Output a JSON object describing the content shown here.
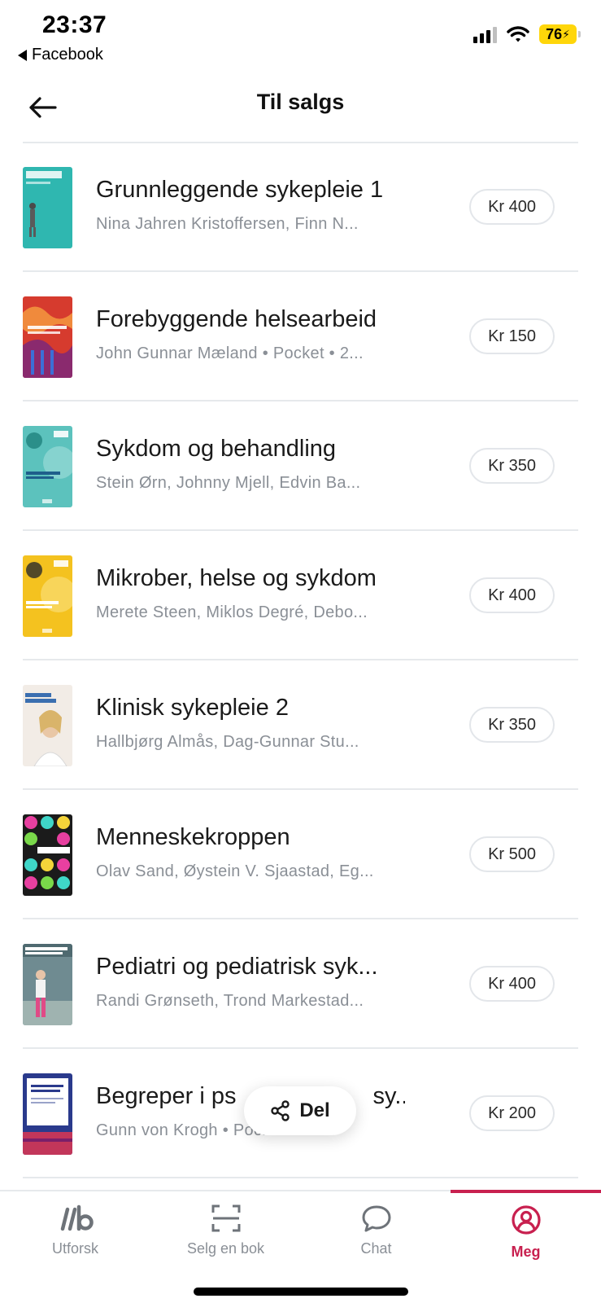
{
  "status": {
    "time": "23:37",
    "back_app": "Facebook",
    "battery": "76"
  },
  "header": {
    "title": "Til salgs"
  },
  "books": [
    {
      "title": "Grunnleggende sykepleie 1",
      "subtitle": "Nina Jahren Kristoffersen, Finn N...",
      "price": "Kr 400",
      "cover_color": "#2fb7b0"
    },
    {
      "title": "Forebyggende helsearbeid",
      "subtitle": "John Gunnar Mæland • Pocket • 2...",
      "price": "Kr 150",
      "cover_color": "#d63b2e"
    },
    {
      "title": "Sykdom og behandling",
      "subtitle": "Stein Ørn, Johnny Mjell, Edvin Ba...",
      "price": "Kr 350",
      "cover_color": "#5cc2bd"
    },
    {
      "title": "Mikrober, helse og sykdom",
      "subtitle": "Merete Steen, Miklos Degré, Debo...",
      "price": "Kr 400",
      "cover_color": "#f4c21f"
    },
    {
      "title": "Klinisk sykepleie 2",
      "subtitle": "Hallbjørg Almås, Dag-Gunnar Stu...",
      "price": "Kr 350",
      "cover_color": "#f2ece6"
    },
    {
      "title": "Menneskekroppen",
      "subtitle": "Olav Sand, Øystein V. Sjaastad, Eg...",
      "price": "Kr 500",
      "cover_color": "#1b1b1b"
    },
    {
      "title": "Pediatri og pediatrisk syk...",
      "subtitle": "Randi Grønseth, Trond Markestad...",
      "price": "Kr 400",
      "cover_color": "#6f8b91"
    },
    {
      "title": "Begreper i ps",
      "title_tail": "sy...",
      "subtitle": "Gunn von Krogh • Pocket • 2005",
      "price": "Kr 200",
      "cover_color": "#2a3a8c"
    }
  ],
  "share": {
    "label": "Del"
  },
  "tabs": [
    {
      "label": "Utforsk",
      "icon": "logo-icon",
      "active": false
    },
    {
      "label": "Selg en bok",
      "icon": "scan-icon",
      "active": false
    },
    {
      "label": "Chat",
      "icon": "chat-bubble-icon",
      "active": false
    },
    {
      "label": "Meg",
      "icon": "profile-icon",
      "active": true
    }
  ],
  "colors": {
    "accent": "#c8204f",
    "muted_text": "#8a8f96",
    "divider": "#e6e9ec"
  }
}
